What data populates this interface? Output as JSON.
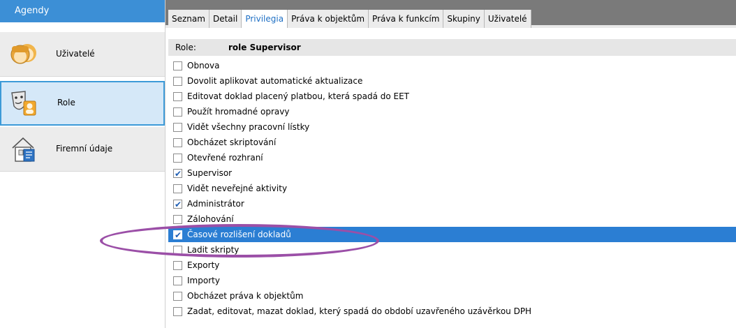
{
  "sidebar": {
    "header": "Agendy",
    "items": [
      {
        "label": "Uživatelé",
        "icon": "users-icon"
      },
      {
        "label": "Role",
        "icon": "role-masks-icon",
        "selected": true
      },
      {
        "label": "Firemní údaje",
        "icon": "company-data-icon"
      }
    ]
  },
  "tabs": [
    {
      "label": "Seznam"
    },
    {
      "label": "Detail"
    },
    {
      "label": "Privilegia",
      "active": true
    },
    {
      "label": "Práva k objektům"
    },
    {
      "label": "Práva k funkcím"
    },
    {
      "label": "Skupiny"
    },
    {
      "label": "Uživatelé"
    }
  ],
  "role": {
    "key": "Role:",
    "value": "role Supervisor"
  },
  "privileges": [
    {
      "label": "Obnova",
      "checked": false
    },
    {
      "label": "Dovolit aplikovat automatické aktualizace",
      "checked": false
    },
    {
      "label": "Editovat doklad placený platbou, která spadá do EET",
      "checked": false
    },
    {
      "label": "Použít hromadné opravy",
      "checked": false
    },
    {
      "label": "Vidět všechny pracovní lístky",
      "checked": false
    },
    {
      "label": "Obcházet skriptování",
      "checked": false
    },
    {
      "label": "Otevřené rozhraní",
      "checked": false
    },
    {
      "label": "Supervisor",
      "checked": true
    },
    {
      "label": "Vidět neveřejné aktivity",
      "checked": false
    },
    {
      "label": "Administrátor",
      "checked": true
    },
    {
      "label": "Zálohování",
      "checked": false
    },
    {
      "label": "Časové rozlišení dokladů",
      "checked": true,
      "highlighted": true
    },
    {
      "label": "Ladit skripty",
      "checked": false
    },
    {
      "label": "Exporty",
      "checked": false
    },
    {
      "label": "Importy",
      "checked": false
    },
    {
      "label": "Obcházet práva k objektům",
      "checked": false
    },
    {
      "label": "Zadat, editovat, mazat doklad, který spadá do období uzavřeného uzávěrkou DPH",
      "checked": false
    }
  ],
  "colors": {
    "accent": "#3c8fd6",
    "highlight": "#2b7ed3",
    "annotation": "#9b4fa7"
  }
}
